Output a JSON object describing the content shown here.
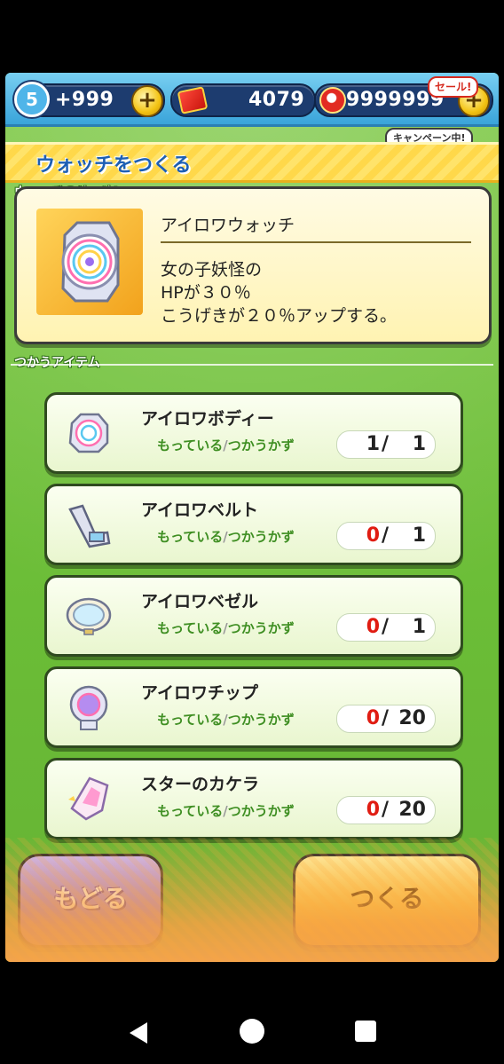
{
  "topbar": {
    "level": "5",
    "stamina": "+999",
    "tickets": "4079",
    "coins": "9999999",
    "sale_badge": "セール!",
    "campaign_badge": "キャンペーン中!"
  },
  "title": "ウォッチをつくる",
  "description": {
    "section_label": "ウォッチのせつめい",
    "watch_name": "アイロワウォッチ",
    "lines": [
      "女の子妖怪の",
      "HPが３０％",
      "こうげきが２０％アップする。"
    ]
  },
  "items_section_label": "つかうアイテム",
  "items": [
    {
      "name": "アイロワボディー",
      "owned_label": "もっている",
      "need_label": "つかうかず",
      "have": "1",
      "need": "1"
    },
    {
      "name": "アイロワベルト",
      "owned_label": "もっている",
      "need_label": "つかうかず",
      "have": "0",
      "need": "1"
    },
    {
      "name": "アイロワベゼル",
      "owned_label": "もっている",
      "need_label": "つかうかず",
      "have": "0",
      "need": "1"
    },
    {
      "name": "アイロワチップ",
      "owned_label": "もっている",
      "need_label": "つかうかず",
      "have": "0",
      "need": "20"
    },
    {
      "name": "スターのカケラ",
      "owned_label": "もっている",
      "need_label": "つかうかず",
      "have": "0",
      "need": "20"
    }
  ],
  "buttons": {
    "back": "もどる",
    "make": "つくる"
  }
}
